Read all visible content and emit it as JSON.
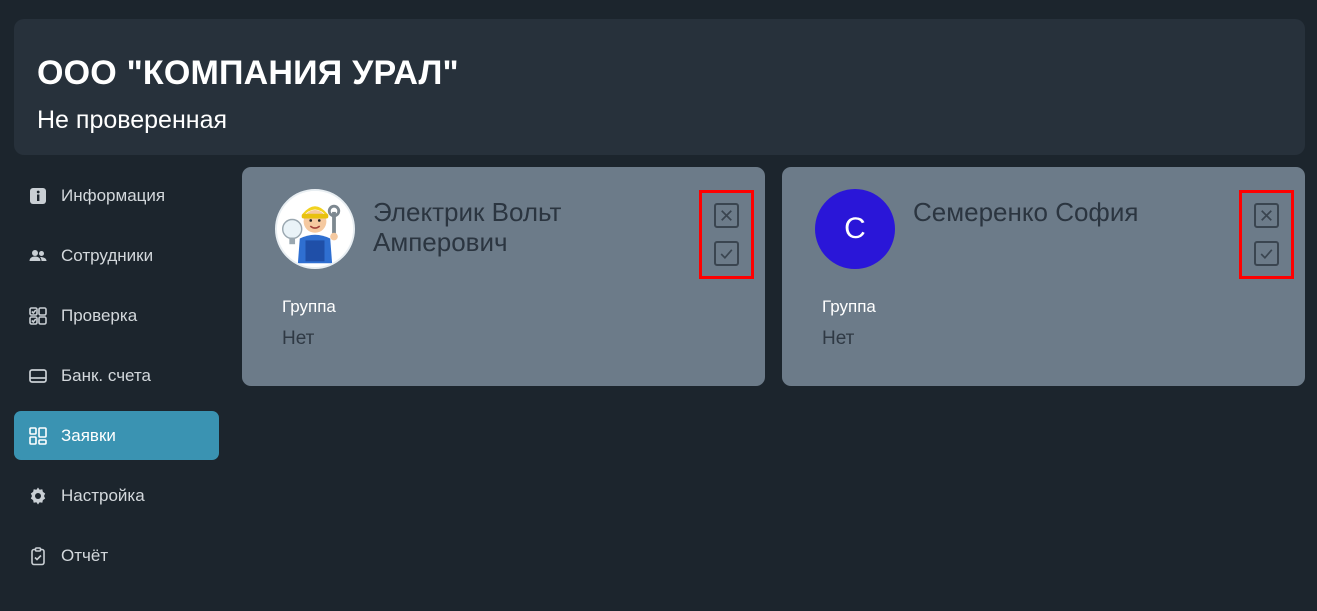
{
  "header": {
    "company_name": "ООО \"КОМПАНИЯ УРАЛ\"",
    "status": "Не проверенная"
  },
  "sidebar": {
    "items": [
      {
        "label": "Информация",
        "icon": "info-icon",
        "active": false
      },
      {
        "label": "Сотрудники",
        "icon": "people-icon",
        "active": false
      },
      {
        "label": "Проверка",
        "icon": "checklist-icon",
        "active": false
      },
      {
        "label": "Банк. счета",
        "icon": "card-icon",
        "active": false
      },
      {
        "label": "Заявки",
        "icon": "dashboard-icon",
        "active": true
      },
      {
        "label": "Настройка",
        "icon": "gear-icon",
        "active": false
      },
      {
        "label": "Отчёт",
        "icon": "clipboard-icon",
        "active": false
      }
    ]
  },
  "requests": [
    {
      "name": "Электрик Вольт Амперович",
      "avatar": "electrician-avatar",
      "group_label": "Группа",
      "group_value": "Нет"
    },
    {
      "name": "Семеренко София",
      "avatar_letter": "С",
      "avatar_color": "#2a16d8",
      "group_label": "Группа",
      "group_value": "Нет"
    }
  ],
  "colors": {
    "background": "#1c252d",
    "header": "#27313b",
    "card": "#6c7b89",
    "active_nav": "#3a93b2",
    "highlight": "#ff0000"
  }
}
